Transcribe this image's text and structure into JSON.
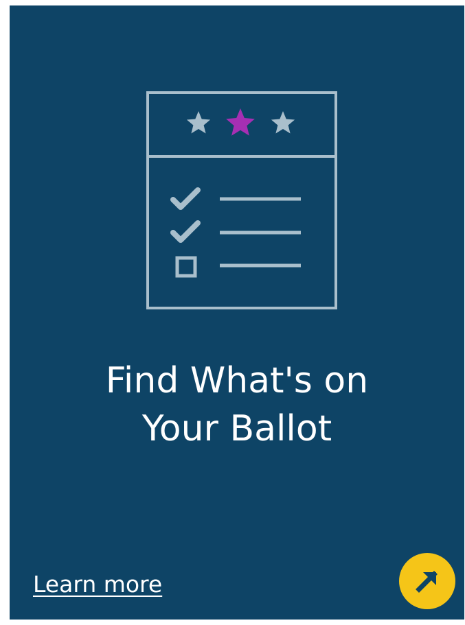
{
  "card": {
    "title_line1": "Find What's on",
    "title_line2": "Your Ballot",
    "link_label": "Learn more",
    "icons": {
      "illustration": "ballot-checklist-icon",
      "action": "arrow-up-right-icon"
    },
    "colors": {
      "background": "#0e4466",
      "text": "#ffffff",
      "outline": "#a9bfcc",
      "star": "#a9bfcc",
      "star_highlight": "#a62fb3",
      "button": "#f5c518",
      "arrow": "#0e4466"
    }
  }
}
